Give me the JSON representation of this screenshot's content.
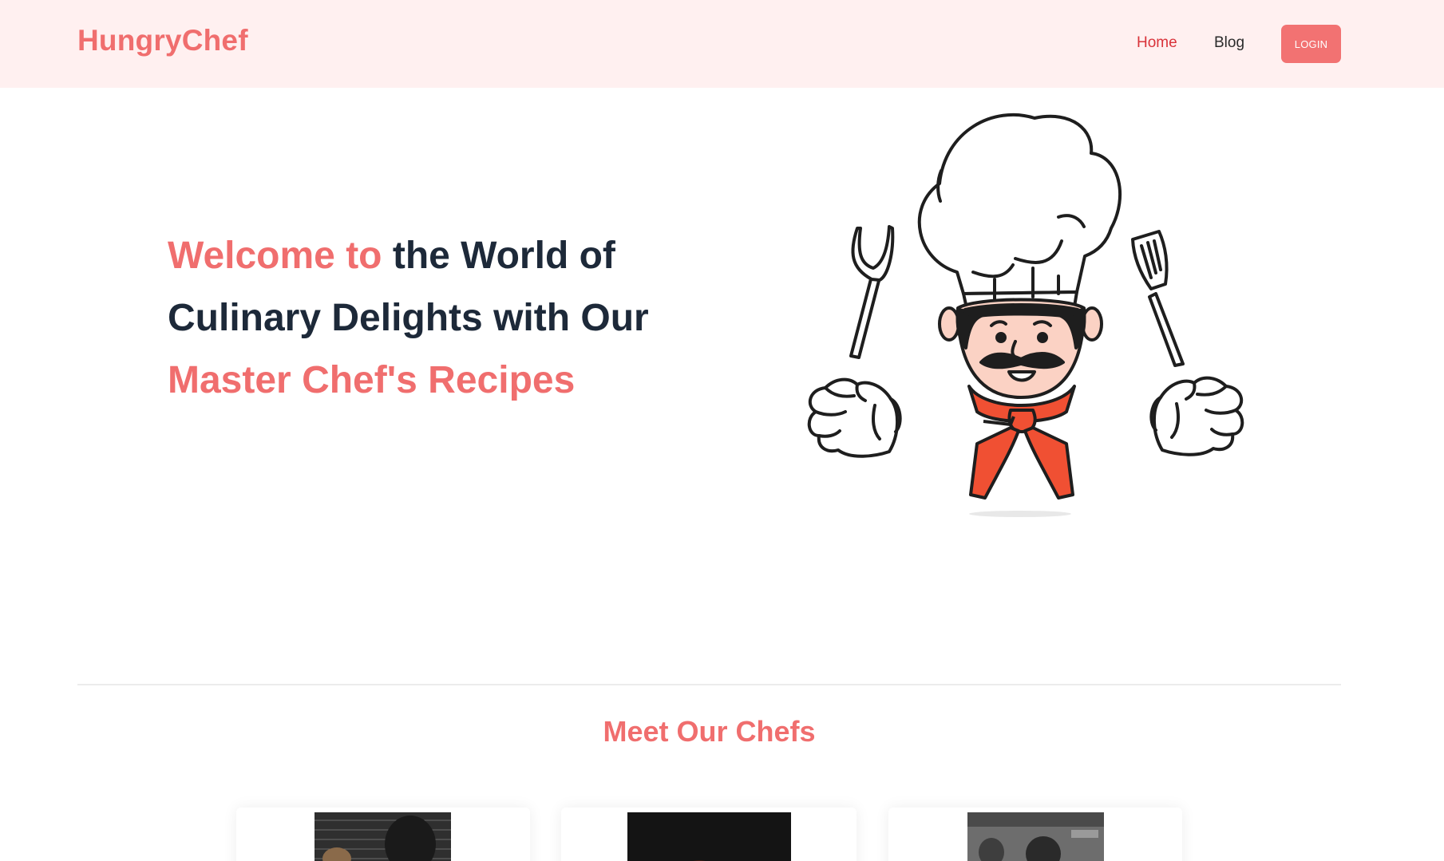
{
  "nav": {
    "brand": "HungryChef",
    "links": [
      {
        "label": "Home",
        "active": true
      },
      {
        "label": "Blog",
        "active": false
      }
    ],
    "login_label": "LOGIN"
  },
  "hero": {
    "title_part1": "Welcome to",
    "title_part2": " the World of Culinary Delights with Our ",
    "title_part3": "Master Chef's Recipes",
    "illustration": "chef-mascot-with-fork-and-spatula"
  },
  "chefs_section": {
    "title": "Meet Our Chefs",
    "cards": [
      {
        "photo": "chef-photo-1"
      },
      {
        "photo": "chef-photo-2"
      },
      {
        "photo": "chef-photo-3"
      }
    ]
  },
  "colors": {
    "accent": "#f06e6e",
    "nav_bg": "#fff0f0",
    "heading": "#1d2939",
    "login_bg": "#f27272",
    "scarf": "#f05033",
    "face": "#fbd2c4"
  }
}
